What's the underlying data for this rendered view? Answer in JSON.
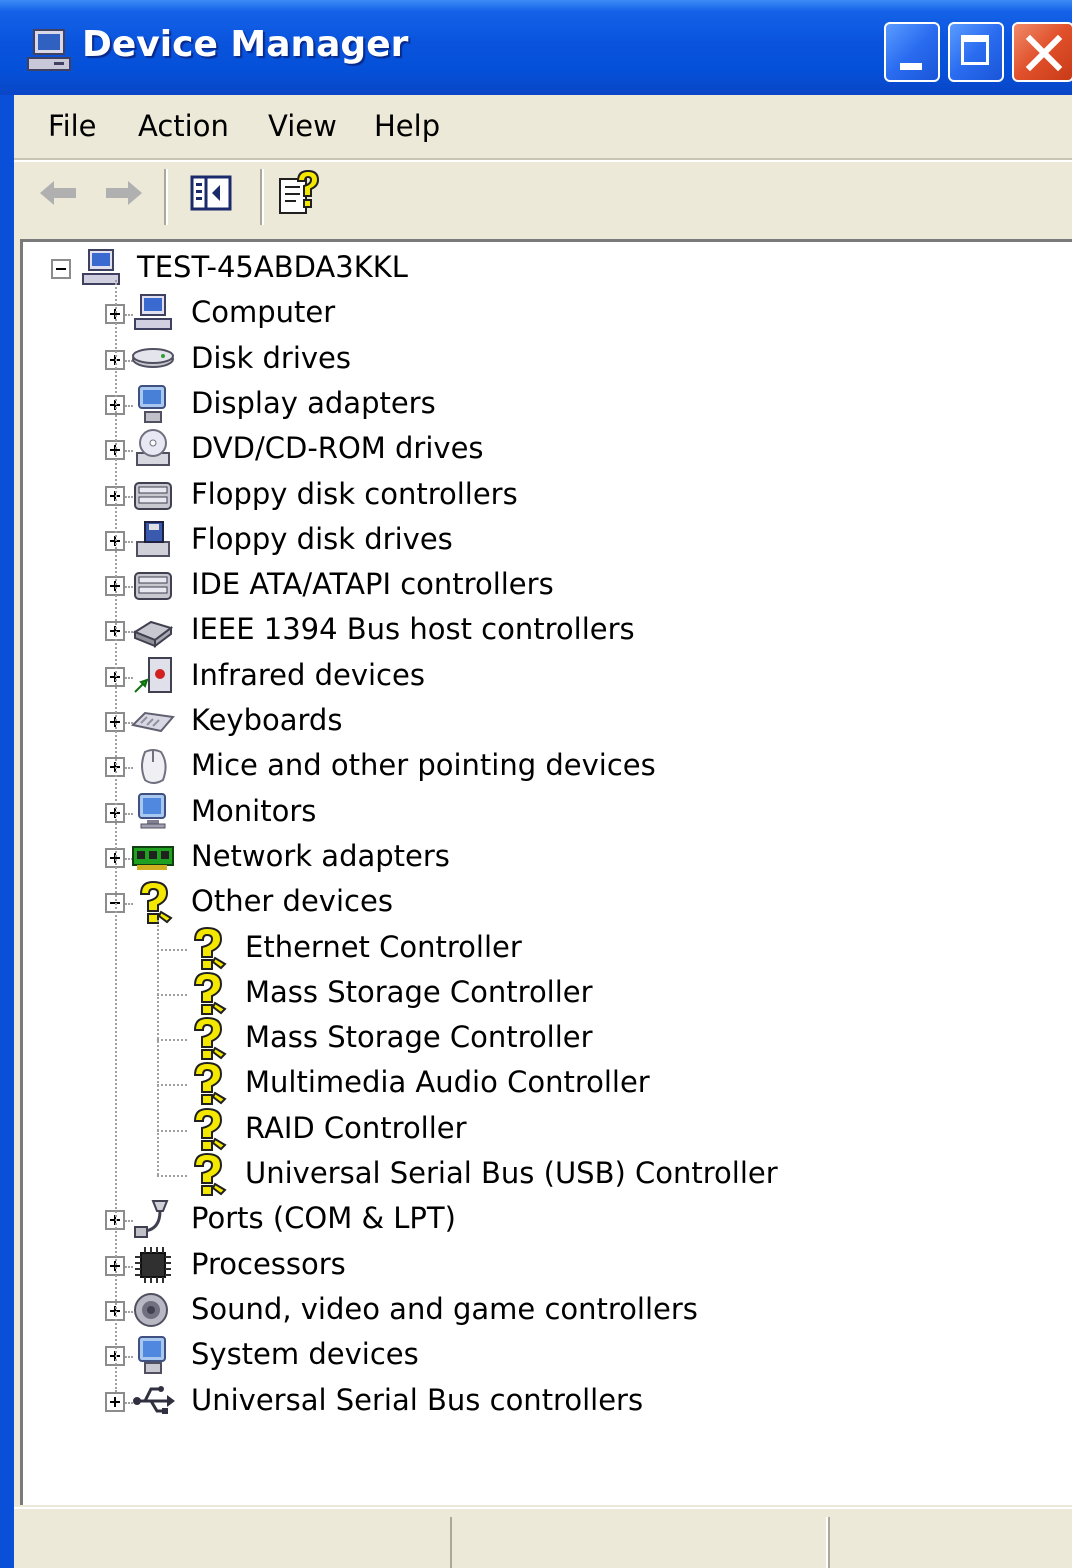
{
  "window": {
    "title": "Device Manager"
  },
  "menu": {
    "file": "File",
    "action": "Action",
    "view": "View",
    "help": "Help"
  },
  "toolbar": {
    "buttons": [
      "back-icon",
      "forward-icon",
      "show-hide-console-tree-icon",
      "help-icon"
    ]
  },
  "tree": {
    "root": {
      "label": "TEST-45ABDA3KKL",
      "icon": "computer-icon",
      "expanded": true
    },
    "categories": [
      {
        "label": "Computer",
        "icon": "computer-icon",
        "expanded": false
      },
      {
        "label": "Disk drives",
        "icon": "disk-drive-icon",
        "expanded": false
      },
      {
        "label": "Display adapters",
        "icon": "display-adapter-icon",
        "expanded": false
      },
      {
        "label": "DVD/CD-ROM drives",
        "icon": "cdrom-icon",
        "expanded": false
      },
      {
        "label": "Floppy disk controllers",
        "icon": "controller-icon",
        "expanded": false
      },
      {
        "label": "Floppy disk drives",
        "icon": "floppy-drive-icon",
        "expanded": false
      },
      {
        "label": "IDE ATA/ATAPI controllers",
        "icon": "controller-icon",
        "expanded": false
      },
      {
        "label": "IEEE 1394 Bus host controllers",
        "icon": "ieee1394-icon",
        "expanded": false
      },
      {
        "label": "Infrared devices",
        "icon": "infrared-icon",
        "expanded": false
      },
      {
        "label": "Keyboards",
        "icon": "keyboard-icon",
        "expanded": false
      },
      {
        "label": "Mice and other pointing devices",
        "icon": "mouse-icon",
        "expanded": false
      },
      {
        "label": "Monitors",
        "icon": "monitor-icon",
        "expanded": false
      },
      {
        "label": "Network adapters",
        "icon": "network-adapter-icon",
        "expanded": false
      },
      {
        "label": "Other devices",
        "icon": "unknown-device-icon",
        "expanded": true,
        "children": [
          {
            "label": "Ethernet Controller",
            "icon": "unknown-device-icon"
          },
          {
            "label": "Mass Storage Controller",
            "icon": "unknown-device-icon"
          },
          {
            "label": "Mass Storage Controller",
            "icon": "unknown-device-icon"
          },
          {
            "label": "Multimedia Audio Controller",
            "icon": "unknown-device-icon"
          },
          {
            "label": "RAID Controller",
            "icon": "unknown-device-icon"
          },
          {
            "label": "Universal Serial Bus (USB) Controller",
            "icon": "unknown-device-icon"
          }
        ]
      },
      {
        "label": "Ports (COM & LPT)",
        "icon": "port-icon",
        "expanded": false
      },
      {
        "label": "Processors",
        "icon": "processor-icon",
        "expanded": false
      },
      {
        "label": "Sound, video and game controllers",
        "icon": "sound-icon",
        "expanded": false
      },
      {
        "label": "System devices",
        "icon": "system-device-icon",
        "expanded": false
      },
      {
        "label": "Universal Serial Bus controllers",
        "icon": "usb-icon",
        "expanded": false
      }
    ]
  },
  "colors": {
    "titlebar": "#0a54dd",
    "frame": "#ece9d8",
    "close_button": "#e0502a",
    "unknown_device": "#f5e800"
  }
}
